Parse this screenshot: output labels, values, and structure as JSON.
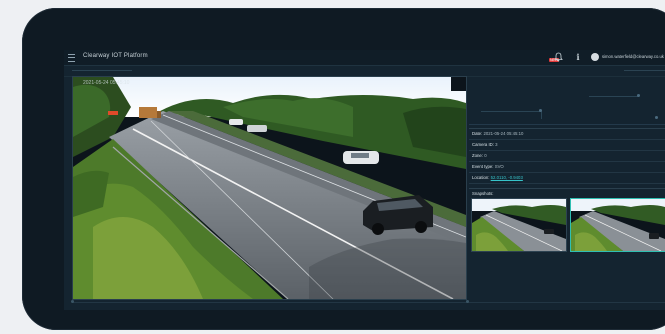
{
  "header": {
    "title": "Clearway IOT Platform",
    "notification_badge": "NEW",
    "info_glyph": "i",
    "user_email": "simon.waterfield@clearway.co.uk"
  },
  "camera": {
    "timestamp": "2021-05-24 05:45:10"
  },
  "event": {
    "rows": [
      {
        "key": "Date:",
        "value": "2021-05-24 05:45:10"
      },
      {
        "key": "Camera ID:",
        "value": "3"
      },
      {
        "key": "Zone:",
        "value": "0"
      },
      {
        "key": "Event type:",
        "value": "SVO"
      },
      {
        "key": "Location:",
        "value": "52.0110, -0.9403"
      }
    ],
    "snapshots_label": "Snapshots:"
  },
  "icons": {
    "menu": "hamburger-icon",
    "bell": "bell-icon",
    "info": "info-icon",
    "avatar": "user-avatar-icon"
  },
  "colors": {
    "accent": "#36c3c9",
    "background": "#142430",
    "alert": "#e23a3a"
  }
}
